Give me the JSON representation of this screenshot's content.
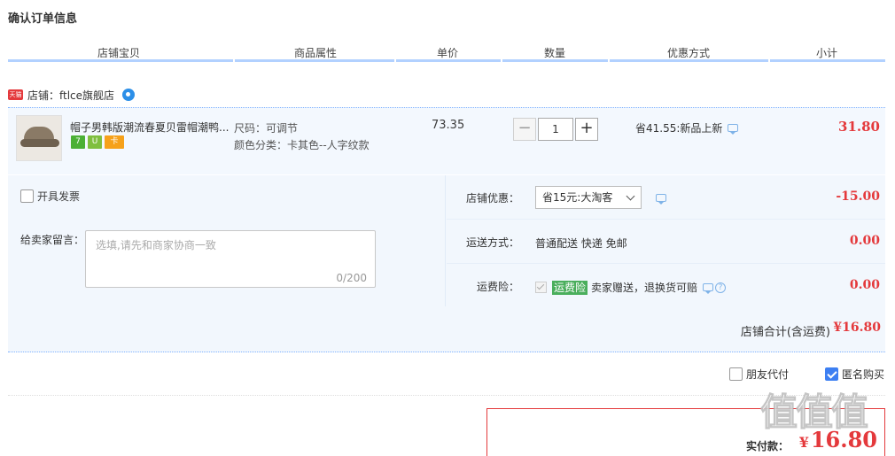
{
  "page_title": "确认订单信息",
  "columns": [
    "店铺宝贝",
    "商品属性",
    "单价",
    "数量",
    "优惠方式",
    "小计"
  ],
  "shop": {
    "badge": "天猫",
    "label": "店铺：ftlce旗舰店"
  },
  "item": {
    "title": "帽子男韩版潮流春夏贝雷帽潮鸭...",
    "badges": [
      "7",
      "U",
      "卡"
    ],
    "size": "尺码：可调节",
    "color": "颜色分类：卡其色--人字纹款",
    "price": "73.35",
    "quantity": "1",
    "minus_label": "−",
    "plus_label": "+",
    "promo": "省41.55:新品上新",
    "subtotal": "31.80"
  },
  "invoice_label": "开具发票",
  "memo": {
    "label": "给卖家留言：",
    "placeholder": "选填,请先和商家协商一致",
    "count": "0/200"
  },
  "discount": {
    "label": "店铺优惠：",
    "selected": "省15元:大淘客",
    "value": "-15.00"
  },
  "shipping": {
    "label": "运送方式：",
    "text": "普通配送 快递 免邮",
    "value": "0.00"
  },
  "insurance": {
    "label": "运费险：",
    "tag": "运费险",
    "text": "卖家赠送，退换货可赔",
    "help": "?",
    "value": "0.00"
  },
  "store_total": {
    "label": "店铺合计(含运费)",
    "value": "¥16.80"
  },
  "options": {
    "friend_pay": "朋友代付",
    "anonymous": "匿名购买",
    "anonymous_checked": true
  },
  "payment": {
    "label": "实付款：",
    "currency": "¥",
    "amount": "16.80"
  },
  "colors": {
    "accent_red": "#e4393c",
    "row_bg": "#f3f8fe",
    "header_line": "#b2d1ff"
  },
  "watermark_text": "值值值"
}
